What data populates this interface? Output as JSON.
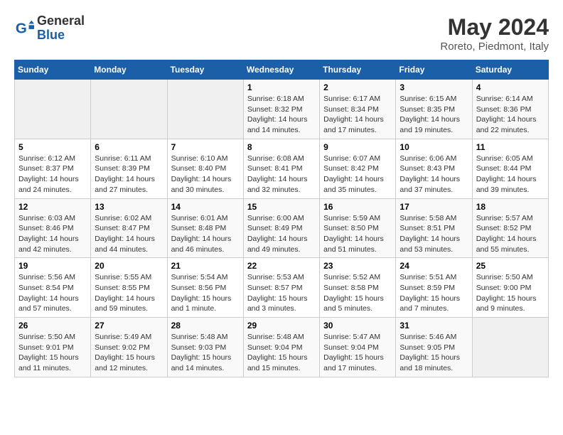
{
  "logo": {
    "general": "General",
    "blue": "Blue"
  },
  "title": "May 2024",
  "location": "Roreto, Piedmont, Italy",
  "days_of_week": [
    "Sunday",
    "Monday",
    "Tuesday",
    "Wednesday",
    "Thursday",
    "Friday",
    "Saturday"
  ],
  "weeks": [
    [
      {
        "day": "",
        "info": ""
      },
      {
        "day": "",
        "info": ""
      },
      {
        "day": "",
        "info": ""
      },
      {
        "day": "1",
        "info": "Sunrise: 6:18 AM\nSunset: 8:32 PM\nDaylight: 14 hours\nand 14 minutes."
      },
      {
        "day": "2",
        "info": "Sunrise: 6:17 AM\nSunset: 8:34 PM\nDaylight: 14 hours\nand 17 minutes."
      },
      {
        "day": "3",
        "info": "Sunrise: 6:15 AM\nSunset: 8:35 PM\nDaylight: 14 hours\nand 19 minutes."
      },
      {
        "day": "4",
        "info": "Sunrise: 6:14 AM\nSunset: 8:36 PM\nDaylight: 14 hours\nand 22 minutes."
      }
    ],
    [
      {
        "day": "5",
        "info": "Sunrise: 6:12 AM\nSunset: 8:37 PM\nDaylight: 14 hours\nand 24 minutes."
      },
      {
        "day": "6",
        "info": "Sunrise: 6:11 AM\nSunset: 8:39 PM\nDaylight: 14 hours\nand 27 minutes."
      },
      {
        "day": "7",
        "info": "Sunrise: 6:10 AM\nSunset: 8:40 PM\nDaylight: 14 hours\nand 30 minutes."
      },
      {
        "day": "8",
        "info": "Sunrise: 6:08 AM\nSunset: 8:41 PM\nDaylight: 14 hours\nand 32 minutes."
      },
      {
        "day": "9",
        "info": "Sunrise: 6:07 AM\nSunset: 8:42 PM\nDaylight: 14 hours\nand 35 minutes."
      },
      {
        "day": "10",
        "info": "Sunrise: 6:06 AM\nSunset: 8:43 PM\nDaylight: 14 hours\nand 37 minutes."
      },
      {
        "day": "11",
        "info": "Sunrise: 6:05 AM\nSunset: 8:44 PM\nDaylight: 14 hours\nand 39 minutes."
      }
    ],
    [
      {
        "day": "12",
        "info": "Sunrise: 6:03 AM\nSunset: 8:46 PM\nDaylight: 14 hours\nand 42 minutes."
      },
      {
        "day": "13",
        "info": "Sunrise: 6:02 AM\nSunset: 8:47 PM\nDaylight: 14 hours\nand 44 minutes."
      },
      {
        "day": "14",
        "info": "Sunrise: 6:01 AM\nSunset: 8:48 PM\nDaylight: 14 hours\nand 46 minutes."
      },
      {
        "day": "15",
        "info": "Sunrise: 6:00 AM\nSunset: 8:49 PM\nDaylight: 14 hours\nand 49 minutes."
      },
      {
        "day": "16",
        "info": "Sunrise: 5:59 AM\nSunset: 8:50 PM\nDaylight: 14 hours\nand 51 minutes."
      },
      {
        "day": "17",
        "info": "Sunrise: 5:58 AM\nSunset: 8:51 PM\nDaylight: 14 hours\nand 53 minutes."
      },
      {
        "day": "18",
        "info": "Sunrise: 5:57 AM\nSunset: 8:52 PM\nDaylight: 14 hours\nand 55 minutes."
      }
    ],
    [
      {
        "day": "19",
        "info": "Sunrise: 5:56 AM\nSunset: 8:54 PM\nDaylight: 14 hours\nand 57 minutes."
      },
      {
        "day": "20",
        "info": "Sunrise: 5:55 AM\nSunset: 8:55 PM\nDaylight: 14 hours\nand 59 minutes."
      },
      {
        "day": "21",
        "info": "Sunrise: 5:54 AM\nSunset: 8:56 PM\nDaylight: 15 hours\nand 1 minute."
      },
      {
        "day": "22",
        "info": "Sunrise: 5:53 AM\nSunset: 8:57 PM\nDaylight: 15 hours\nand 3 minutes."
      },
      {
        "day": "23",
        "info": "Sunrise: 5:52 AM\nSunset: 8:58 PM\nDaylight: 15 hours\nand 5 minutes."
      },
      {
        "day": "24",
        "info": "Sunrise: 5:51 AM\nSunset: 8:59 PM\nDaylight: 15 hours\nand 7 minutes."
      },
      {
        "day": "25",
        "info": "Sunrise: 5:50 AM\nSunset: 9:00 PM\nDaylight: 15 hours\nand 9 minutes."
      }
    ],
    [
      {
        "day": "26",
        "info": "Sunrise: 5:50 AM\nSunset: 9:01 PM\nDaylight: 15 hours\nand 11 minutes."
      },
      {
        "day": "27",
        "info": "Sunrise: 5:49 AM\nSunset: 9:02 PM\nDaylight: 15 hours\nand 12 minutes."
      },
      {
        "day": "28",
        "info": "Sunrise: 5:48 AM\nSunset: 9:03 PM\nDaylight: 15 hours\nand 14 minutes."
      },
      {
        "day": "29",
        "info": "Sunrise: 5:48 AM\nSunset: 9:04 PM\nDaylight: 15 hours\nand 15 minutes."
      },
      {
        "day": "30",
        "info": "Sunrise: 5:47 AM\nSunset: 9:04 PM\nDaylight: 15 hours\nand 17 minutes."
      },
      {
        "day": "31",
        "info": "Sunrise: 5:46 AM\nSunset: 9:05 PM\nDaylight: 15 hours\nand 18 minutes."
      },
      {
        "day": "",
        "info": ""
      }
    ]
  ]
}
